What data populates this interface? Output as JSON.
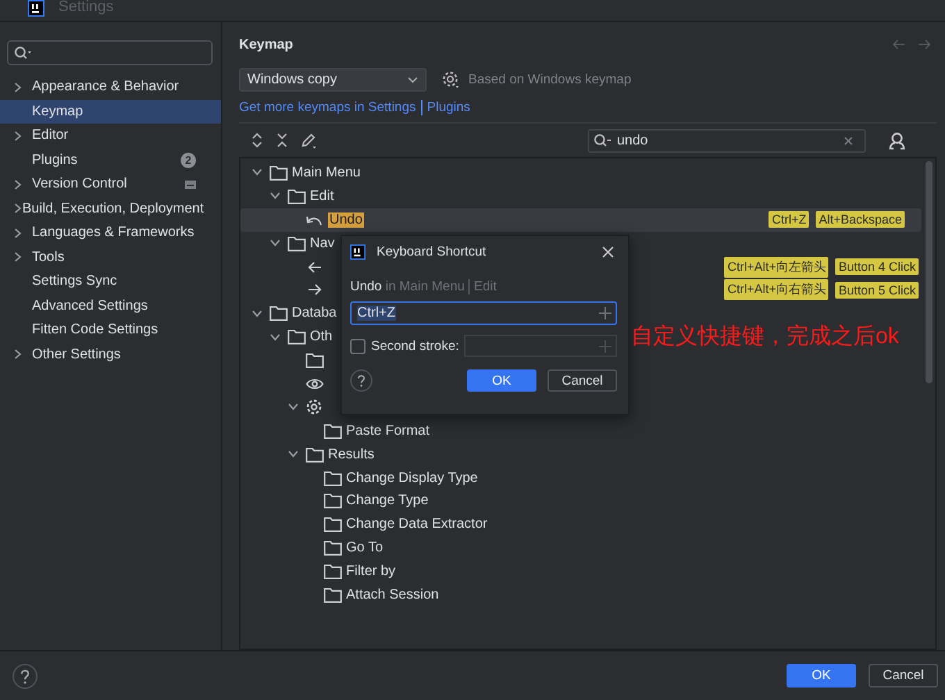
{
  "window": {
    "title": "Settings"
  },
  "sidebar": {
    "items": [
      {
        "label": "Appearance & Behavior",
        "has_children": true,
        "selected": false
      },
      {
        "label": "Keymap",
        "has_children": false,
        "selected": true
      },
      {
        "label": "Editor",
        "has_children": true,
        "selected": false
      },
      {
        "label": "Plugins",
        "has_children": false,
        "selected": false,
        "badge": "2"
      },
      {
        "label": "Version Control",
        "has_children": true,
        "selected": false,
        "project_icon": true
      },
      {
        "label": "Build, Execution, Deployment",
        "has_children": true,
        "selected": false
      },
      {
        "label": "Languages & Frameworks",
        "has_children": true,
        "selected": false
      },
      {
        "label": "Tools",
        "has_children": true,
        "selected": false
      },
      {
        "label": "Settings Sync",
        "has_children": false,
        "selected": false
      },
      {
        "label": "Advanced Settings",
        "has_children": false,
        "selected": false
      },
      {
        "label": "Fitten Code Settings",
        "has_children": false,
        "selected": false
      },
      {
        "label": "Other Settings",
        "has_children": true,
        "selected": false
      }
    ]
  },
  "keymap": {
    "title": "Keymap",
    "scheme": "Windows copy",
    "based_on": "Based on Windows keymap",
    "links": [
      "Get more keymaps in Settings",
      "Plugins"
    ],
    "search": {
      "value": "undo"
    },
    "tree": [
      {
        "label": "Main Menu",
        "kind": "folder",
        "expanded": true,
        "selected": false,
        "children": [
          {
            "label": "Edit",
            "kind": "folder",
            "expanded": true,
            "selected": false,
            "children": [
              {
                "label": "Undo",
                "kind": "undo",
                "selected": true,
                "matched": true,
                "shortcuts": [
                  "Ctrl+Z",
                  "Alt+Backspace"
                ]
              }
            ]
          },
          {
            "label": "Nav",
            "kind": "folder",
            "expanded": true,
            "selected": false,
            "children": [
              {
                "kind": "back",
                "selected": false,
                "shortcuts": [
                  "Ctrl+Alt+向左箭头",
                  "Button 4 Click"
                ]
              },
              {
                "kind": "forward",
                "selected": false,
                "shortcuts": [
                  "Ctrl+Alt+向右箭头",
                  "Button 5 Click"
                ]
              }
            ]
          }
        ]
      },
      {
        "label": "Databa",
        "kind": "folder",
        "expanded": true,
        "selected": false,
        "children": [
          {
            "label": "Oth",
            "kind": "folder",
            "expanded": true,
            "selected": false,
            "children": [
              {
                "kind": "folder",
                "selected": false
              },
              {
                "kind": "eye",
                "selected": false
              },
              {
                "kind": "gear",
                "expanded": true,
                "selected": false,
                "children": [
                  {
                    "label": "Paste Format",
                    "kind": "folder",
                    "selected": false
                  }
                ]
              },
              {
                "label": "Results",
                "kind": "folder",
                "expanded": true,
                "selected": false,
                "children": [
                  {
                    "label": "Change Display Type",
                    "kind": "folder",
                    "selected": false
                  },
                  {
                    "label": "Change Type",
                    "kind": "folder",
                    "selected": false
                  },
                  {
                    "label": "Change Data Extractor",
                    "kind": "folder",
                    "selected": false
                  },
                  {
                    "label": "Go To",
                    "kind": "folder",
                    "selected": false
                  },
                  {
                    "label": "Filter by",
                    "kind": "folder",
                    "selected": false
                  },
                  {
                    "label": "Attach Session",
                    "kind": "folder",
                    "selected": false
                  }
                ]
              }
            ]
          }
        ]
      }
    ]
  },
  "dialog": {
    "title": "Keyboard Shortcut",
    "action": "Undo",
    "context": "in Main Menu",
    "group": "Edit",
    "first_stroke": "Ctrl+Z",
    "second_stroke": {
      "label": "Second stroke:",
      "checked": false
    },
    "buttons": [
      {
        "label": "OK",
        "primary": true
      },
      {
        "label": "Cancel",
        "primary": false
      }
    ]
  },
  "annotation": {
    "text": "自定义快捷键，完成之后ok"
  },
  "footer": {
    "buttons": [
      {
        "label": "OK",
        "primary": true
      },
      {
        "label": "Cancel",
        "primary": false
      }
    ]
  }
}
